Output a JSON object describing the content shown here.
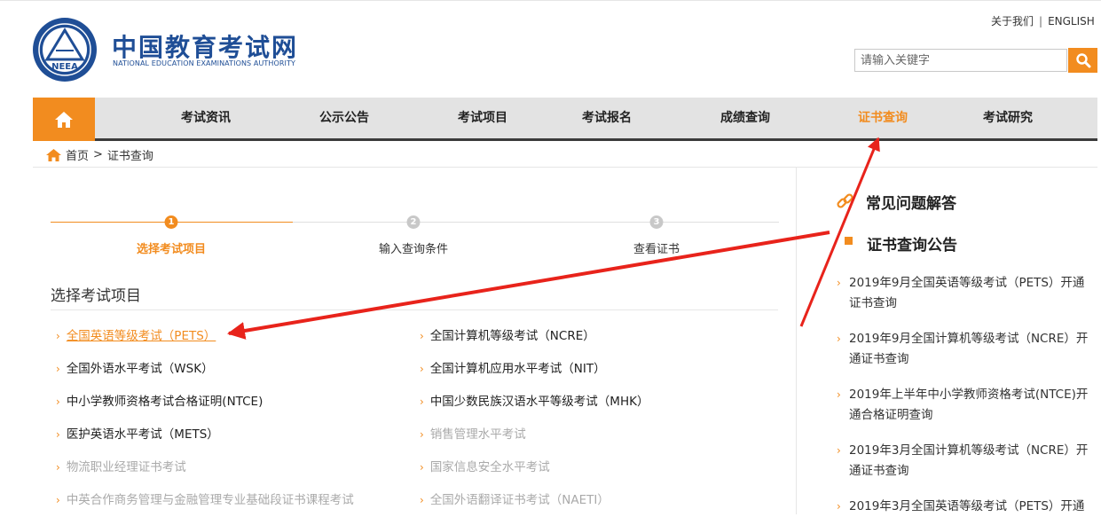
{
  "logo": {
    "emblem_text": "NEEA",
    "name_cn": "中国教育考试网",
    "name_en": "NATIONAL EDUCATION EXAMINATIONS AUTHORITY"
  },
  "top_links": {
    "about": "关于我们",
    "separator": "|",
    "english": "ENGLISH"
  },
  "search": {
    "placeholder": "请输入关键字",
    "icon": "search-icon"
  },
  "nav": {
    "home_icon": "home-icon",
    "items": [
      "考试资讯",
      "公示公告",
      "考试项目",
      "考试报名",
      "成绩查询",
      "证书查询",
      "考试研究"
    ],
    "active": "证书查询"
  },
  "breadcrumb": {
    "home": "首页",
    "separator": ">",
    "current": "证书查询"
  },
  "steps": [
    {
      "number": "1",
      "label": "选择考试项目",
      "state": "active"
    },
    {
      "number": "2",
      "label": "输入查询条件",
      "state": "inactive"
    },
    {
      "number": "3",
      "label": "查看证书",
      "state": "inactive"
    }
  ],
  "section_title": "选择考试项目",
  "exams_left": [
    {
      "label": "全国英语等级考试（PETS）",
      "state": "highlighted"
    },
    {
      "label": "全国外语水平考试（WSK）",
      "state": "enabled"
    },
    {
      "label": "中小学教师资格考试合格证明(NTCE)",
      "state": "enabled"
    },
    {
      "label": "医护英语水平考试（METS）",
      "state": "enabled"
    },
    {
      "label": "物流职业经理证书考试",
      "state": "disabled"
    },
    {
      "label": "中英合作商务管理与金融管理专业基础段证书课程考试",
      "state": "disabled"
    }
  ],
  "exams_right": [
    {
      "label": "全国计算机等级考试（NCRE）",
      "state": "enabled"
    },
    {
      "label": "全国计算机应用水平考试（NIT）",
      "state": "enabled"
    },
    {
      "label": "中国少数民族汉语水平等级考试（MHK）",
      "state": "enabled"
    },
    {
      "label": "销售管理水平考试",
      "state": "disabled"
    },
    {
      "label": "国家信息安全水平考试",
      "state": "disabled"
    },
    {
      "label": "全国外语翻译证书考试（NAETI）",
      "state": "disabled"
    }
  ],
  "sidebar": {
    "faq_title": "常见问题解答",
    "faq_icon": "link-icon",
    "notice_title": "证书查询公告",
    "news": [
      "2019年9月全国英语等级考试（PETS）开通证书查询",
      "2019年9月全国计算机等级考试（NCRE）开通证书查询",
      "2019年上半年中小学教师资格考试(NTCE)开通合格证明查询",
      "2019年3月全国计算机等级考试（NCRE）开通证书查询",
      "2019年3月全国英语等级考试（PETS）开通"
    ]
  },
  "colors": {
    "accent": "#f28c1f",
    "brand_blue": "#1f4e96",
    "annotation_arrow": "#e8231b",
    "nav_bg": "#e3e3e3",
    "disabled_text": "#aaaaaa"
  }
}
